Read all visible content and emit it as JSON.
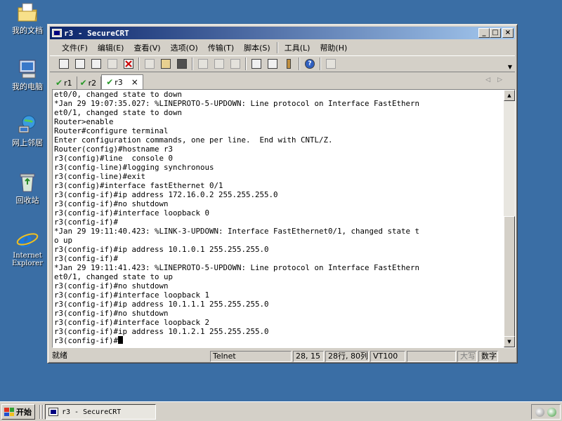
{
  "desktop": {
    "icons": [
      {
        "label": "我的文档",
        "icon": "my-documents-icon"
      },
      {
        "label": "我的电脑",
        "icon": "my-computer-icon"
      },
      {
        "label": "网上邻居",
        "icon": "network-places-icon"
      },
      {
        "label": "回收站",
        "icon": "recycle-bin-icon"
      },
      {
        "label": "Internet Explorer",
        "icon": "internet-explorer-icon"
      }
    ]
  },
  "window": {
    "title": "r3 - SecureCRT",
    "controls": {
      "minimize": "_",
      "maximize": "□",
      "close": "×"
    }
  },
  "menu": {
    "items": [
      "文件(F)",
      "编辑(E)",
      "查看(V)",
      "选项(O)",
      "传输(T)",
      "脚本(S)",
      "工具(L)",
      "帮助(H)"
    ]
  },
  "tabs": [
    {
      "label": "r1",
      "active": false
    },
    {
      "label": "r2",
      "active": false
    },
    {
      "label": "r3",
      "active": true,
      "close": "×"
    }
  ],
  "terminal": {
    "lines": [
      "et0/0, changed state to down",
      "*Jan 29 19:07:35.027: %LINEPROTO-5-UPDOWN: Line protocol on Interface FastEthern",
      "et0/1, changed state to down",
      "Router>enable",
      "Router#configure terminal",
      "Enter configuration commands, one per line.  End with CNTL/Z.",
      "Router(config)#hostname r3",
      "r3(config)#line  console 0",
      "r3(config-line)#logging synchronous",
      "r3(config-line)#exit",
      "r3(config)#interface fastEthernet 0/1",
      "r3(config-if)#ip address 172.16.0.2 255.255.255.0",
      "r3(config-if)#no shutdown",
      "r3(config-if)#interface loopback 0",
      "r3(config-if)#",
      "*Jan 29 19:11:40.423: %LINK-3-UPDOWN: Interface FastEthernet0/1, changed state t",
      "o up",
      "r3(config-if)#ip address 10.1.0.1 255.255.255.0",
      "r3(config-if)#",
      "*Jan 29 19:11:41.423: %LINEPROTO-5-UPDOWN: Line protocol on Interface FastEthern",
      "et0/1, changed state to up",
      "r3(config-if)#no shutdown",
      "r3(config-if)#interface loopback 1",
      "r3(config-if)#ip address 10.1.1.1 255.255.255.0",
      "r3(config-if)#no shutdown",
      "r3(config-if)#interface loopback 2",
      "r3(config-if)#ip address 10.1.2.1 255.255.255.0"
    ],
    "prompt": "r3(config-if)#"
  },
  "status": {
    "ready": "就绪",
    "protocol": "Telnet",
    "cursor_pos": "28, 15",
    "size": "28行, 80列",
    "emulation": "VT100",
    "caps": "大写",
    "num": "数字"
  },
  "taskbar": {
    "start": "开始",
    "task": "r3 - SecureCRT"
  }
}
